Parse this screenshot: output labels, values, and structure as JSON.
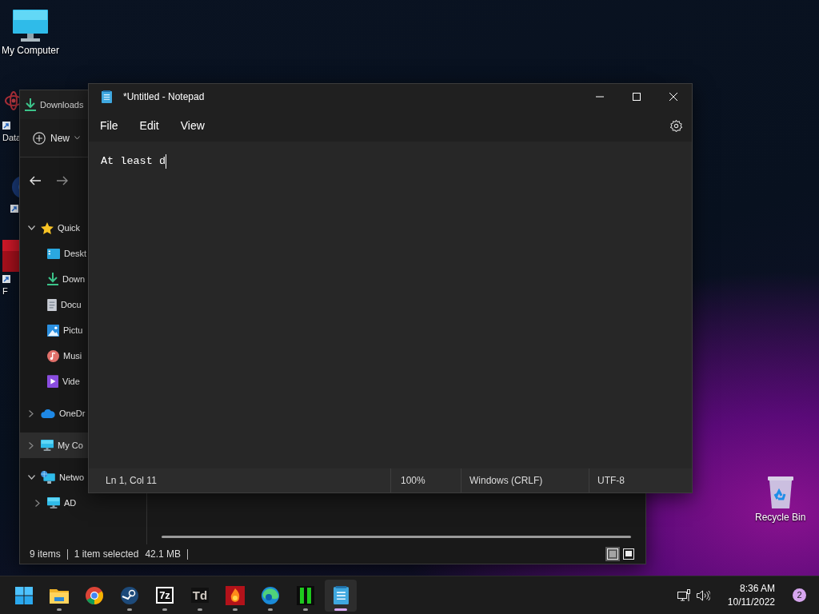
{
  "desktop_icons": [
    {
      "kind": "computer",
      "label": "My Computer"
    },
    {
      "kind": "atom",
      "label": "Data"
    },
    {
      "kind": "disc"
    },
    {
      "kind": "red-app",
      "label": "F"
    },
    {
      "kind": "recycle",
      "label": "Recycle Bin"
    }
  ],
  "explorer": {
    "title": "Downloads",
    "new_button": "New",
    "nav": [
      {
        "label": "Quick",
        "kind": "star",
        "expanded": true,
        "selected": false,
        "children": [
          {
            "label": "Deskt",
            "kind": "desktop",
            "selected": false
          },
          {
            "label": "Down",
            "kind": "download",
            "selected": false
          },
          {
            "label": "Docu",
            "kind": "document",
            "selected": false
          },
          {
            "label": "Pictu",
            "kind": "picture",
            "selected": false
          },
          {
            "label": "Musi",
            "kind": "music",
            "selected": false
          },
          {
            "label": "Vide",
            "kind": "video",
            "selected": false
          }
        ]
      },
      {
        "label": "OneDr",
        "kind": "cloud",
        "expanded": false,
        "selected": false
      },
      {
        "label": "My Co",
        "kind": "computer",
        "expanded": false,
        "selected": true
      },
      {
        "label": "Netwo",
        "kind": "network",
        "expanded": true,
        "selected": false,
        "children": [
          {
            "label": "AD",
            "kind": "computer",
            "expanded": false,
            "selected": false
          }
        ]
      }
    ],
    "status": {
      "items": "9 items",
      "selection": "1 item selected",
      "size": "42.1 MB"
    },
    "view_buttons": [
      {
        "kind": "details",
        "selected": true
      },
      {
        "kind": "tiles",
        "selected": false
      }
    ]
  },
  "notepad": {
    "title": "*Untitled - Notepad",
    "menu": [
      "File",
      "Edit",
      "View"
    ],
    "text": "At least d",
    "status": [
      "Ln 1, Col 11",
      "100%",
      "Windows (CRLF)",
      "UTF-8"
    ]
  },
  "taskbar": {
    "apps": [
      {
        "kind": "start",
        "running": false,
        "selected": false
      },
      {
        "kind": "folder",
        "running": true,
        "selected": false
      },
      {
        "kind": "chrome",
        "running": false,
        "selected": false
      },
      {
        "kind": "steam",
        "running": true,
        "selected": false
      },
      {
        "kind": "sevenzip",
        "glyph": "7z",
        "running": true,
        "selected": false
      },
      {
        "kind": "td",
        "glyph": "Td",
        "running": true,
        "selected": false
      },
      {
        "kind": "flame",
        "running": true,
        "selected": false
      },
      {
        "kind": "edge",
        "running": true,
        "selected": false
      },
      {
        "kind": "bars",
        "running": true,
        "selected": false
      },
      {
        "kind": "notepad",
        "running": true,
        "selected": true
      }
    ],
    "time": "8:36 AM",
    "date": "10/11/2022",
    "notifications": "2"
  }
}
